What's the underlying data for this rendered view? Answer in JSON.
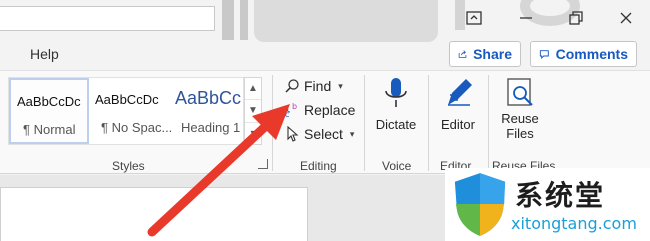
{
  "tabs": {
    "help": "Help"
  },
  "header": {
    "share_label": "Share",
    "comments_label": "Comments"
  },
  "styles": {
    "items": [
      {
        "sample": "AaBbCcDc",
        "name": "¶ Normal"
      },
      {
        "sample": "AaBbCcDc",
        "name": "¶ No Spac..."
      },
      {
        "sample": "AaBbCc",
        "name": "Heading 1"
      }
    ],
    "group_label": "Styles"
  },
  "editing": {
    "find_label": "Find",
    "replace_label": "Replace",
    "select_label": "Select",
    "group_label": "Editing"
  },
  "voice": {
    "dictate_label": "Dictate",
    "group_label": "Voice"
  },
  "editor": {
    "editor_label": "Editor",
    "group_label": "Editor"
  },
  "reuse": {
    "label_line1": "Reuse",
    "label_line2": "Files",
    "group_label": "Reuse Files"
  },
  "watermark": {
    "text": "系统堂",
    "url": "xitongtang.com"
  },
  "colors": {
    "accent": "#185abd",
    "arrow": "#e8392b",
    "ribbon": "#f9f9f9"
  }
}
